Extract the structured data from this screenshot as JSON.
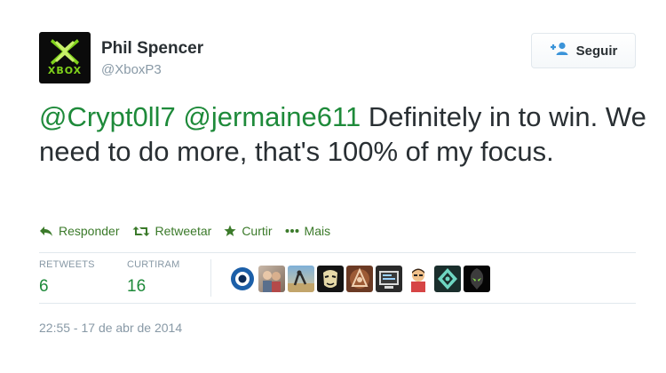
{
  "author": {
    "name": "Phil Spencer",
    "handle": "@XboxP3",
    "avatar_logo_text": "XBOX"
  },
  "follow_button": {
    "label": "Seguir",
    "icon": "person-plus-icon"
  },
  "tweet": {
    "mention_1": "@Crypt0ll7",
    "mention_2": "@jermaine611",
    "body_text": "Definitely in to win.  We need to do more, that's 100% of my focus."
  },
  "actions": [
    {
      "label": "Responder",
      "icon": "reply-icon"
    },
    {
      "label": "Retweetar",
      "icon": "retweet-icon"
    },
    {
      "label": "Curtir",
      "icon": "star-icon"
    },
    {
      "label": "Mais",
      "icon": "more-dots-icon"
    }
  ],
  "stats": {
    "retweets_label": "RETWEETS",
    "retweets_value": "6",
    "likes_label": "CURTIRAM",
    "likes_value": "16"
  },
  "likers_count_shown": 10,
  "timestamp": "22:55 - 17 de abr de 2014",
  "colors": {
    "accent_green": "#1e8a3a",
    "action_green": "#3b7a2a",
    "muted_gray": "#8899a6",
    "text_dark": "#292f33",
    "border": "#e1e8ed",
    "xbox_green": "#7fd11b"
  }
}
